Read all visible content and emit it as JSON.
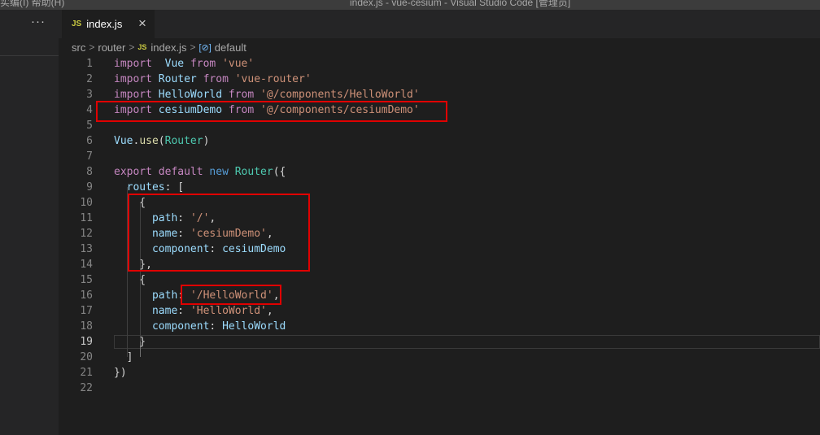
{
  "window": {
    "title": "index.js - vue-cesium - Visual Studio Code [管理员]",
    "menu": "实编(I)  帮助(H)"
  },
  "sidebar": {
    "more_label": "···"
  },
  "tab": {
    "icon_label": "JS",
    "filename": "index.js",
    "close_label": "×"
  },
  "breadcrumb": {
    "items": [
      "src",
      "router",
      "index.js",
      "default"
    ],
    "js_label": "JS",
    "symbol_label": "[⊘]"
  },
  "editor": {
    "active_line": 19,
    "lines": [
      {
        "n": "1",
        "t": [
          [
            "kw",
            "import"
          ],
          [
            "",
            "  "
          ],
          [
            "var",
            "Vue"
          ],
          [
            "",
            " "
          ],
          [
            "kw",
            "from"
          ],
          [
            "",
            " "
          ],
          [
            "str",
            "'vue'"
          ]
        ]
      },
      {
        "n": "2",
        "t": [
          [
            "kw",
            "import"
          ],
          [
            "",
            " "
          ],
          [
            "var",
            "Router"
          ],
          [
            "",
            " "
          ],
          [
            "kw",
            "from"
          ],
          [
            "",
            " "
          ],
          [
            "str",
            "'vue-router'"
          ]
        ]
      },
      {
        "n": "3",
        "t": [
          [
            "kw",
            "import"
          ],
          [
            "",
            " "
          ],
          [
            "var",
            "HelloWorld"
          ],
          [
            "",
            " "
          ],
          [
            "kw",
            "from"
          ],
          [
            "",
            " "
          ],
          [
            "str",
            "'@/components/HelloWorld'"
          ]
        ]
      },
      {
        "n": "4",
        "t": [
          [
            "kw",
            "import"
          ],
          [
            "",
            " "
          ],
          [
            "var",
            "cesiumDemo"
          ],
          [
            "",
            " "
          ],
          [
            "kw",
            "from"
          ],
          [
            "",
            " "
          ],
          [
            "str",
            "'@/components/cesiumDemo'"
          ]
        ]
      },
      {
        "n": "5",
        "t": []
      },
      {
        "n": "6",
        "t": [
          [
            "var",
            "Vue"
          ],
          [
            "",
            "."
          ],
          [
            "fn",
            "use"
          ],
          [
            "",
            "("
          ],
          [
            "cls",
            "Router"
          ],
          [
            "",
            ")"
          ]
        ]
      },
      {
        "n": "7",
        "t": []
      },
      {
        "n": "8",
        "t": [
          [
            "kw",
            "export"
          ],
          [
            "",
            " "
          ],
          [
            "kw",
            "default"
          ],
          [
            "",
            " "
          ],
          [
            "kw2",
            "new"
          ],
          [
            "",
            " "
          ],
          [
            "cls",
            "Router"
          ],
          [
            "",
            "({"
          ]
        ]
      },
      {
        "n": "9",
        "t": [
          [
            "",
            "  "
          ],
          [
            "var",
            "routes"
          ],
          [
            "",
            ": ["
          ]
        ]
      },
      {
        "n": "10",
        "t": [
          [
            "",
            "    {"
          ]
        ]
      },
      {
        "n": "11",
        "t": [
          [
            "",
            "      "
          ],
          [
            "var",
            "path"
          ],
          [
            "",
            ": "
          ],
          [
            "str",
            "'/'"
          ],
          [
            "",
            ","
          ]
        ]
      },
      {
        "n": "12",
        "t": [
          [
            "",
            "      "
          ],
          [
            "var",
            "name"
          ],
          [
            "",
            ": "
          ],
          [
            "str",
            "'cesiumDemo'"
          ],
          [
            "",
            ","
          ]
        ]
      },
      {
        "n": "13",
        "t": [
          [
            "",
            "      "
          ],
          [
            "var",
            "component"
          ],
          [
            "",
            ": "
          ],
          [
            "var",
            "cesiumDemo"
          ]
        ]
      },
      {
        "n": "14",
        "t": [
          [
            "",
            "    },"
          ]
        ]
      },
      {
        "n": "15",
        "t": [
          [
            "",
            "    {"
          ]
        ]
      },
      {
        "n": "16",
        "t": [
          [
            "",
            "      "
          ],
          [
            "var",
            "path"
          ],
          [
            "",
            ": "
          ],
          [
            "str",
            "'/HelloWorld'"
          ],
          [
            "",
            ","
          ]
        ]
      },
      {
        "n": "17",
        "t": [
          [
            "",
            "      "
          ],
          [
            "var",
            "name"
          ],
          [
            "",
            ": "
          ],
          [
            "str",
            "'HelloWorld'"
          ],
          [
            "",
            ","
          ]
        ]
      },
      {
        "n": "18",
        "t": [
          [
            "",
            "      "
          ],
          [
            "var",
            "component"
          ],
          [
            "",
            ": "
          ],
          [
            "var",
            "HelloWorld"
          ]
        ]
      },
      {
        "n": "19",
        "t": [
          [
            "",
            "    }"
          ]
        ]
      },
      {
        "n": "20",
        "t": [
          [
            "",
            "  ]"
          ]
        ]
      },
      {
        "n": "21",
        "t": [
          [
            "",
            "})"
          ]
        ]
      },
      {
        "n": "22",
        "t": []
      }
    ]
  },
  "colors": {
    "keyword": "#c586c0",
    "string": "#ce9178",
    "variable": "#9cdcfe",
    "class": "#4ec9b0",
    "function": "#dcdcaa",
    "highlight_box": "#e00000"
  }
}
